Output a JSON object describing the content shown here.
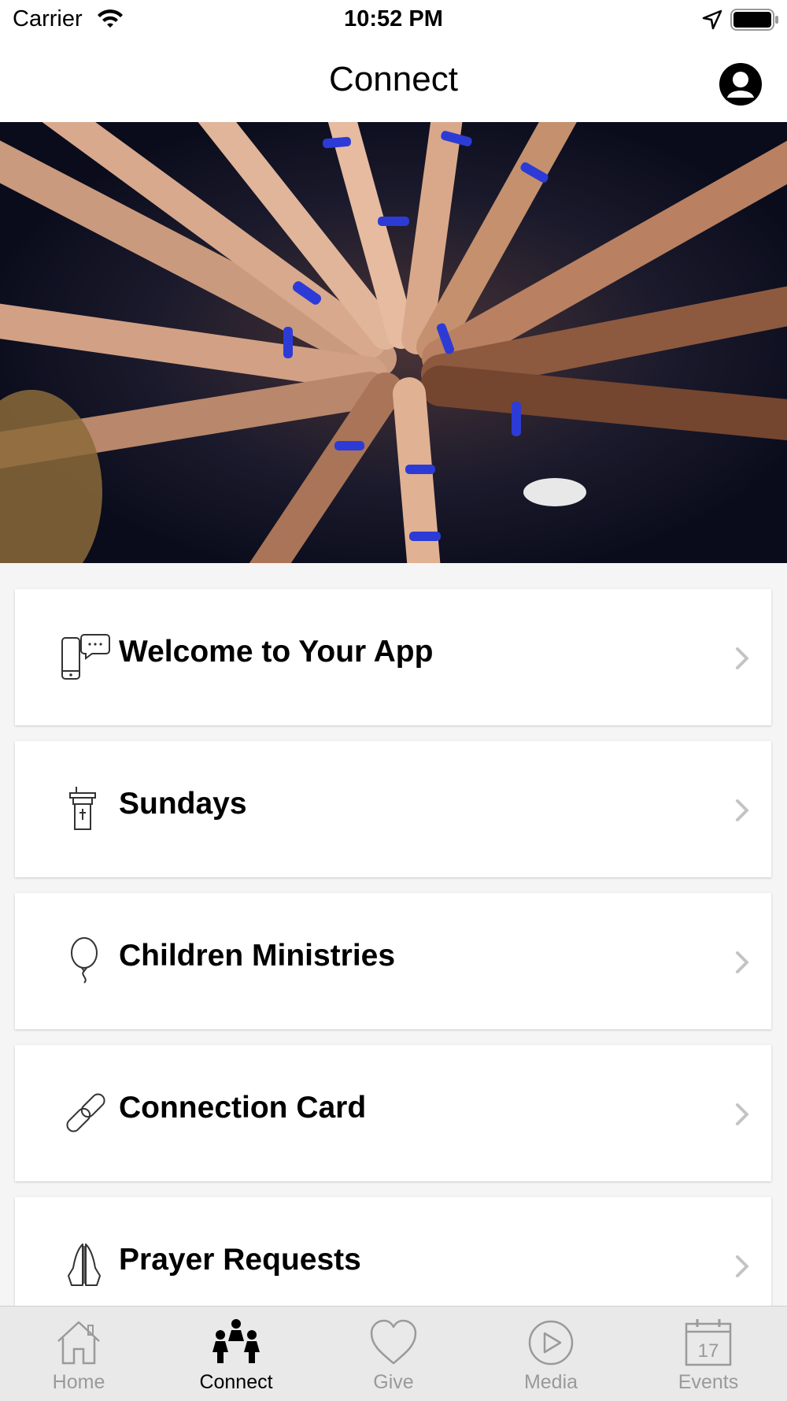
{
  "status_bar": {
    "carrier": "Carrier",
    "time": "10:52 PM",
    "icons": [
      "wifi-icon",
      "location-arrow-icon",
      "battery-icon"
    ]
  },
  "nav": {
    "title": "Connect",
    "profile_icon": "profile-avatar-icon"
  },
  "hero": {
    "description_icon": "hands-together-photo"
  },
  "menu": {
    "items": [
      {
        "label": "Welcome to Your App",
        "icon": "phone-chat-icon"
      },
      {
        "label": "Sundays",
        "icon": "pulpit-icon"
      },
      {
        "label": "Children Ministries",
        "icon": "balloon-icon"
      },
      {
        "label": "Connection Card",
        "icon": "link-icon"
      },
      {
        "label": "Prayer Requests",
        "icon": "praying-hands-icon"
      }
    ]
  },
  "tabs": [
    {
      "label": "Home",
      "icon": "house-icon",
      "active": false
    },
    {
      "label": "Connect",
      "icon": "people-icon",
      "active": true
    },
    {
      "label": "Give",
      "icon": "heart-icon",
      "active": false
    },
    {
      "label": "Media",
      "icon": "play-circle-icon",
      "active": false
    },
    {
      "label": "Events",
      "icon": "calendar-icon",
      "active": false,
      "calendar_day": "17"
    }
  ],
  "colors": {
    "accent_band": "#2d3bd6",
    "inactive_tab": "#9a9a9a",
    "tab_bar_bg": "#e9e9e9"
  }
}
